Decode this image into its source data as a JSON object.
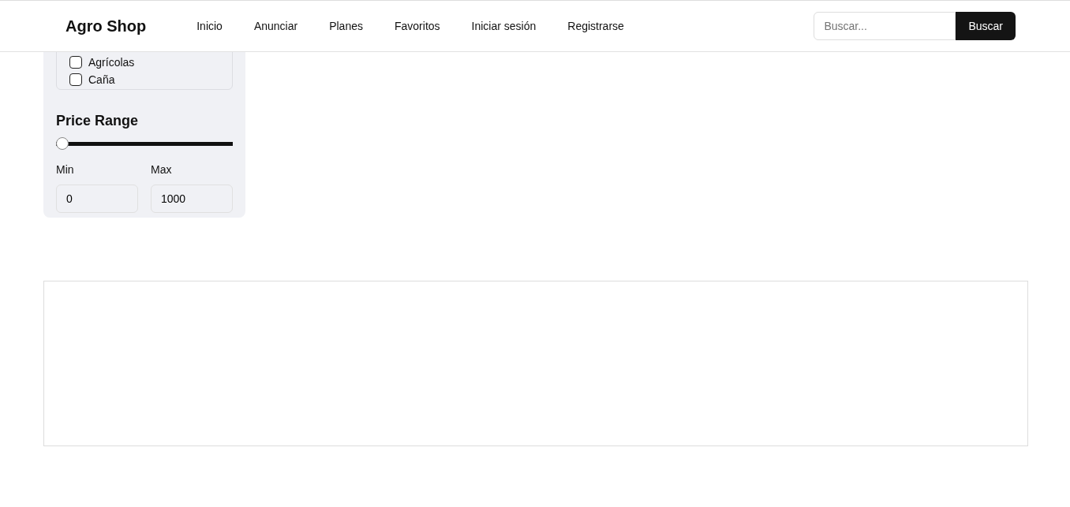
{
  "navbar": {
    "brand": "Agro Shop",
    "links": [
      {
        "label": "Inicio"
      },
      {
        "label": "Anunciar"
      },
      {
        "label": "Planes"
      },
      {
        "label": "Favoritos"
      },
      {
        "label": "Iniciar sesión"
      },
      {
        "label": "Registrarse"
      }
    ],
    "search": {
      "placeholder": "Buscar...",
      "button": "Buscar"
    }
  },
  "filters": {
    "categories": [
      {
        "label": "Agrícolas",
        "checked": false
      },
      {
        "label": "Caña",
        "checked": false
      }
    ],
    "price_range": {
      "title": "Price Range",
      "level": 0,
      "min_label": "Min",
      "min_value": "0",
      "max_label": "Max",
      "max_value": "1000"
    }
  }
}
